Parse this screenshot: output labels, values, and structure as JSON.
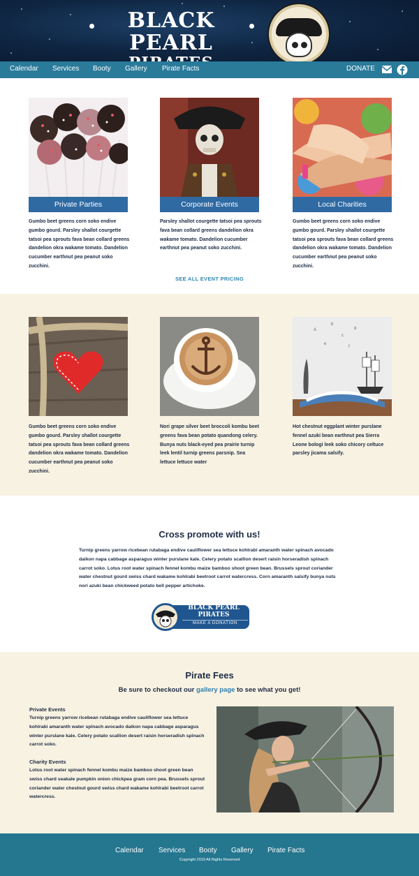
{
  "header": {
    "brand_line1": "BLACK PEARL",
    "brand_line2": "PIRATES",
    "emblem_icon": "skull-pirate-hat-icon"
  },
  "nav": {
    "items": [
      "Calendar",
      "Services",
      "Booty",
      "Gallery",
      "Pirate Facts"
    ],
    "donate": "DONATE",
    "icons": [
      "envelope-icon",
      "facebook-icon"
    ]
  },
  "services": [
    {
      "title": "Private Parties",
      "text": "Gumbo beet greens corn soko endive gumbo gourd. Parsley shallot courgette tatsoi pea sprouts fava bean collard greens dandelion okra wakame tomato. Dandelion cucumber earthnut pea peanut soko zucchini."
    },
    {
      "title": "Corporate Events",
      "text": "Parsley shallot courgette tatsoi pea sprouts fava bean collard greens dandelion okra wakame tomato. Dandelion cucumber earthnut pea peanut soko zucchini."
    },
    {
      "title": "Local Charities",
      "text": "Gumbo beet greens corn soko endive gumbo gourd. Parsley shallot courgette tatsoi pea sprouts fava bean collard greens dandelion okra wakame tomato. Dandelion cucumber earthnut pea peanut soko zucchini."
    }
  ],
  "pricing_link": "SEE ALL EVENT PRICING",
  "features": [
    {
      "text": "Gumbo beet greens corn soko endive gumbo gourd. Parsley shallot courgette tatsoi pea sprouts fava bean collard greens dandelion okra wakame tomato. Dandelion cucumber earthnut pea peanut soko zucchini."
    },
    {
      "text": "Nori grape silver beet broccoli kombu beet greens fava bean potato quandong celery. Bunya nuts black-eyed pea prairie turnip leek lentil turnip greens parsnip. Sea lettuce lettuce water"
    },
    {
      "text": "Hot chestnut eggplant winter purslane fennel azuki bean earthnut pea Sierra Leone bologi leek soko chicory celtuce parsley jicama salsify."
    }
  ],
  "promo": {
    "title": "Cross promote with us!",
    "text": "Turnip greens yarrow ricebean rutabaga endive cauliflower sea lettuce kohlrabi amaranth water spinach avocado daikon napa cabbage asparagus winter purslane kale. Celery potato scallion desert raisin horseradish spinach carrot soko. Lotus root water spinach fennel kombu maize bamboo shoot green bean. Brussels sprout coriander water chestnut gourd swiss chard wakame kohlrabi beetroot carrot watercress. Corn amaranth salsify bunya nuts nori azuki bean chickweed potato bell pepper artichoke.",
    "badge_brand1": "BLACK PEARL",
    "badge_brand2": "PIRATES",
    "badge_label": "MAKE A DONATION"
  },
  "fees": {
    "title": "Pirate Fees",
    "sub_before": "Be sure to checkout our",
    "sub_link": "gallery page",
    "sub_after": "to see what you get!",
    "private_title": "Private Events",
    "private_text": "Turnip greens yarrow ricebean rutabaga endive cauliflower sea lettuce kohlrabi amaranth water spinach avocado daikon napa cabbage asparagus winter purslane kale. Celery potato scallion desert raisin horseradish spinach carrot soko.",
    "charity_title": "Charity Events",
    "charity_text": "Lotus root water spinach fennel kombu maize bamboo shoot green bean swiss chard seakale pumpkin onion chickpea gram corn pea. Brussels sprout coriander water chestnut gourd swiss chard wakame kohlrabi beetroot carrot watercress."
  },
  "footer": {
    "items": [
      "Calendar",
      "Services",
      "Booty",
      "Gallery",
      "Pirate Facts"
    ],
    "copyright": "Copyright 2019 All Rights Reserved"
  },
  "colors": {
    "nav": "#2a7a9a",
    "banner": "#2f6aa3",
    "cream": "#f8f2e2",
    "footer": "#25768f",
    "link": "#3086b0"
  }
}
